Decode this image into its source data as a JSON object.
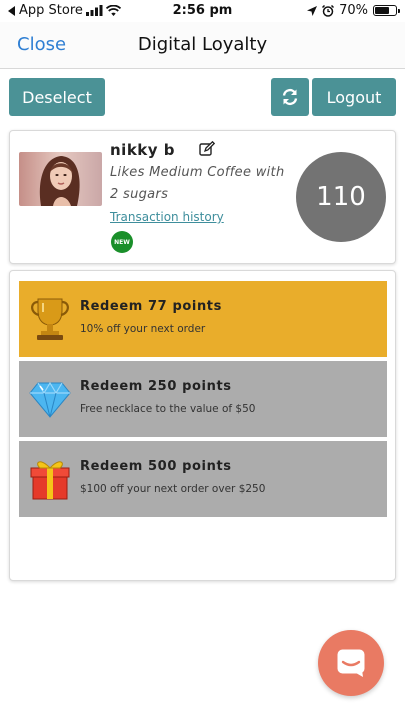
{
  "status_bar": {
    "back_app": "App Store",
    "time": "2:56 pm",
    "battery_percent": "70%",
    "battery_level": 0.7
  },
  "nav": {
    "close_label": "Close",
    "title": "Digital Loyalty"
  },
  "actions": {
    "deselect_label": "Deselect",
    "refresh_icon": "refresh-icon",
    "logout_label": "Logout"
  },
  "profile": {
    "name": "nikky b",
    "preference": "Likes Medium Coffee with 2 sugars",
    "transaction_link": "Transaction history",
    "badge": "NEW",
    "points": "110"
  },
  "rewards": [
    {
      "title": "Redeem 77 points",
      "description": "10% off your next order",
      "icon": "trophy-icon",
      "color": "#e9ad2b"
    },
    {
      "title": "Redeem 250 points",
      "description": "Free necklace to the value of $50",
      "icon": "diamond-icon",
      "color": "#acacac"
    },
    {
      "title": "Redeem 500 points",
      "description": "$100 off your next order over $250",
      "icon": "gift-icon",
      "color": "#acacac"
    }
  ],
  "colors": {
    "primary": "#4b9296",
    "link": "#2f7fd3",
    "available": "#e9ad2b",
    "locked": "#acacac",
    "fab": "#e97a63"
  }
}
